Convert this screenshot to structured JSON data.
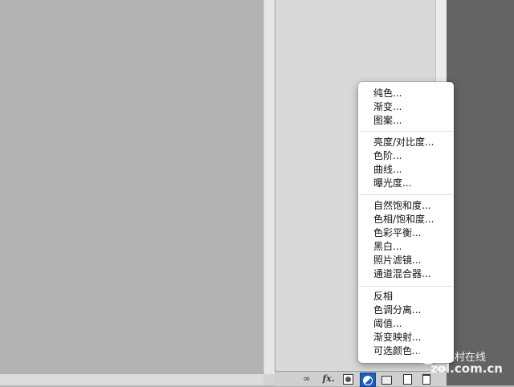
{
  "menu": {
    "groups": [
      {
        "items": [
          "纯色...",
          "渐变...",
          "图案..."
        ]
      },
      {
        "items": [
          "亮度/对比度...",
          "色阶...",
          "曲线...",
          "曝光度..."
        ]
      },
      {
        "items": [
          "自然饱和度...",
          "色相/饱和度...",
          "色彩平衡...",
          "黑白...",
          "照片滤镜...",
          "通道混合器..."
        ]
      },
      {
        "items": [
          "反相",
          "色调分离...",
          "阈值...",
          "渐变映射...",
          "可选颜色..."
        ]
      }
    ]
  },
  "toolbar": {
    "link_icon": "∞",
    "fx_label": "fx.",
    "icons": [
      "link-layers-icon",
      "layer-style-icon",
      "layer-mask-icon",
      "adjustment-layer-icon",
      "group-folder-icon",
      "new-layer-icon",
      "delete-icon"
    ]
  },
  "watermark": {
    "cn": "中关村在线",
    "en": "zol.com.cn"
  },
  "colors": {
    "canvas_bg": "#b3b3b3",
    "panel_bg": "#d9d9d9",
    "dark_bg": "#646464",
    "active_button": "#1d5fbf",
    "menu_bg": "#ffffff"
  }
}
